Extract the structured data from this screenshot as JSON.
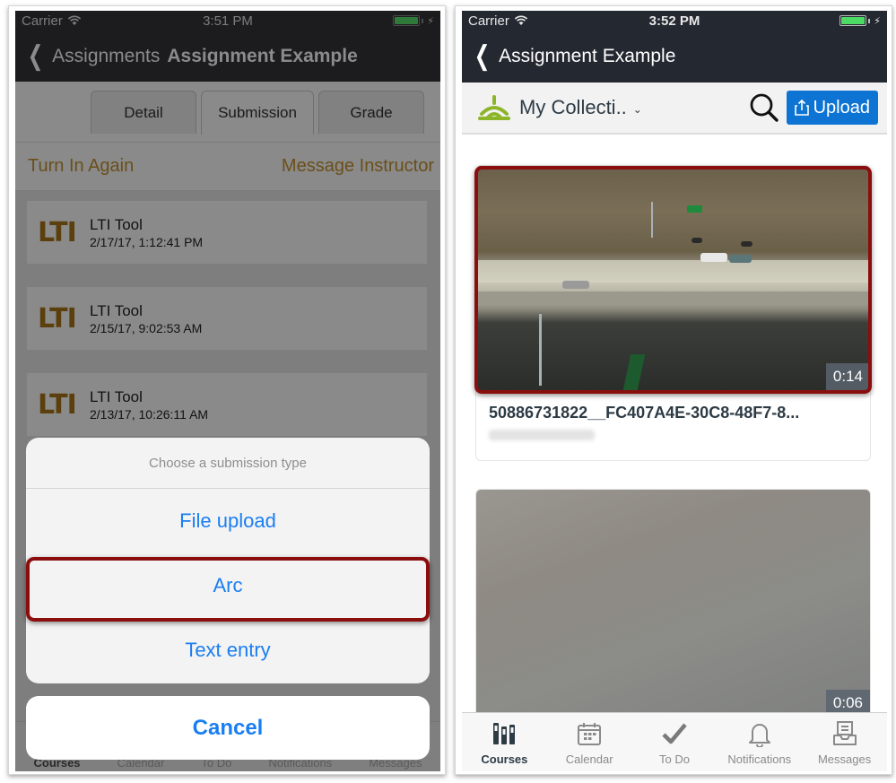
{
  "left_screen": {
    "status": {
      "carrier": "Carrier",
      "time": "3:51 PM"
    },
    "nav": {
      "back_label": "Assignments",
      "title": "Assignment Example"
    },
    "tabs": [
      {
        "label": "Detail",
        "active": false
      },
      {
        "label": "Submission",
        "active": true
      },
      {
        "label": "Grade",
        "active": false
      }
    ],
    "actions": {
      "turn_in_again": "Turn In Again",
      "message_instructor": "Message Instructor"
    },
    "submissions": [
      {
        "logo": "LTI",
        "title": "LTI Tool",
        "date": "2/17/17, 1:12:41 PM"
      },
      {
        "logo": "LTI",
        "title": "LTI Tool",
        "date": "2/15/17, 9:02:53 AM"
      },
      {
        "logo": "LTI",
        "title": "LTI Tool",
        "date": "2/13/17, 10:26:11 AM"
      }
    ],
    "action_sheet": {
      "title": "Choose a submission type",
      "options": [
        "File upload",
        "Arc",
        "Text entry"
      ],
      "highlighted_option": "Arc",
      "cancel": "Cancel"
    },
    "tab_bar": [
      "Courses",
      "Calendar",
      "To Do",
      "Notifications",
      "Messages"
    ]
  },
  "right_screen": {
    "status": {
      "carrier": "Carrier",
      "time": "3:52 PM"
    },
    "nav": {
      "title": "Assignment Example"
    },
    "toolbar": {
      "collection": "My Collecti..",
      "upload_label": "Upload",
      "logo_color": "#8db52a",
      "upload_color": "#0e74d4"
    },
    "videos": [
      {
        "title": "50886731822__FC407A4E-30C8-48F7-8...",
        "duration": "0:14",
        "highlighted": true
      },
      {
        "title": "",
        "duration": "0:06",
        "highlighted": false
      }
    ],
    "tab_bar": [
      {
        "label": "Courses",
        "icon": "courses-icon",
        "active": true
      },
      {
        "label": "Calendar",
        "icon": "calendar-icon",
        "active": false
      },
      {
        "label": "To Do",
        "icon": "checkmark-icon",
        "active": false
      },
      {
        "label": "Notifications",
        "icon": "bell-icon",
        "active": false
      },
      {
        "label": "Messages",
        "icon": "inbox-icon",
        "active": false
      }
    ]
  },
  "colors": {
    "highlight_outline": "#8b0e0e",
    "ios_blue": "#1a7ef2",
    "battery_green": "#4cd964"
  }
}
